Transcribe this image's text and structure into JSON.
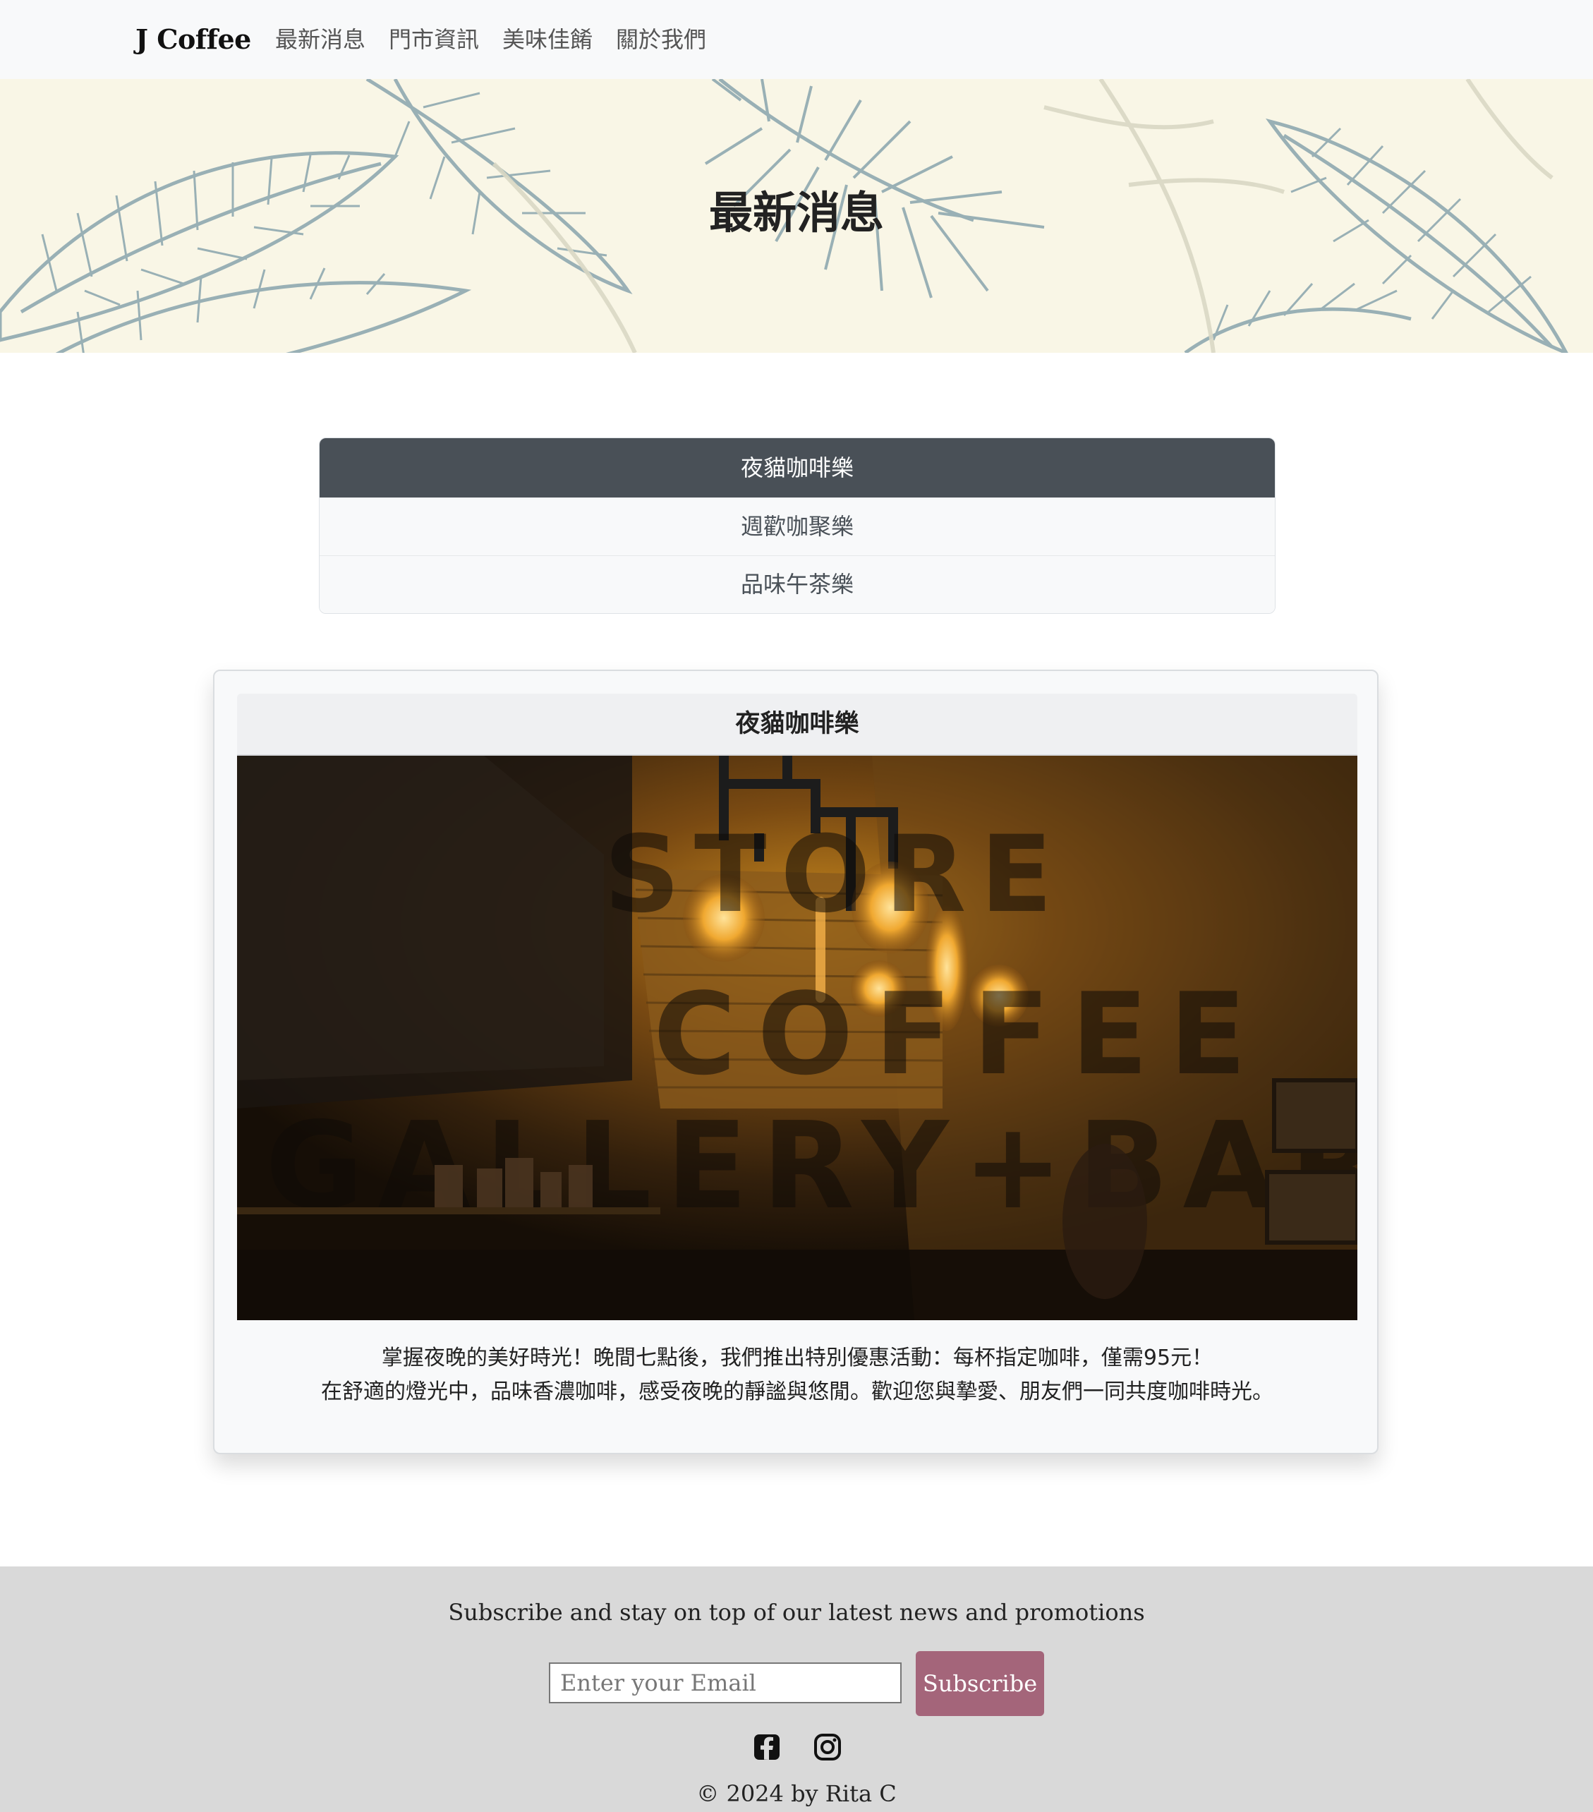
{
  "navbar": {
    "brand": "J Coffee",
    "links": [
      "最新消息",
      "門市資訊",
      "美味佳餚",
      "關於我們"
    ]
  },
  "hero": {
    "title": "最新消息"
  },
  "news_tabs": {
    "items": [
      "夜貓咖啡樂",
      "週歡咖聚樂",
      "品味午茶樂"
    ],
    "active_index": 0
  },
  "card": {
    "title": "夜貓咖啡樂",
    "image_icon": "cafe-interior-photo",
    "text_line1": "掌握夜晚的美好時光！晚間七點後，我們推出特別優惠活動：每杯指定咖啡，僅需95元！",
    "text_line2": "在舒適的燈光中，品味香濃咖啡，感受夜晚的靜謐與悠閒。歡迎您與摯愛、朋友們一同共度咖啡時光。"
  },
  "footer": {
    "tagline": "Subscribe and stay on top of our latest news and promotions",
    "email_placeholder": "Enter your Email",
    "subscribe_label": "Subscribe",
    "social_icons": [
      "facebook-icon",
      "instagram-icon"
    ],
    "copyright": "© 2024 by Rita C"
  },
  "colors": {
    "navbar_bg": "#f8f9fa",
    "hero_bg": "#f9f6e6",
    "active_tab": "#495057",
    "subscribe_btn": "#a4657a",
    "footer_bg": "#d9d9d9"
  }
}
